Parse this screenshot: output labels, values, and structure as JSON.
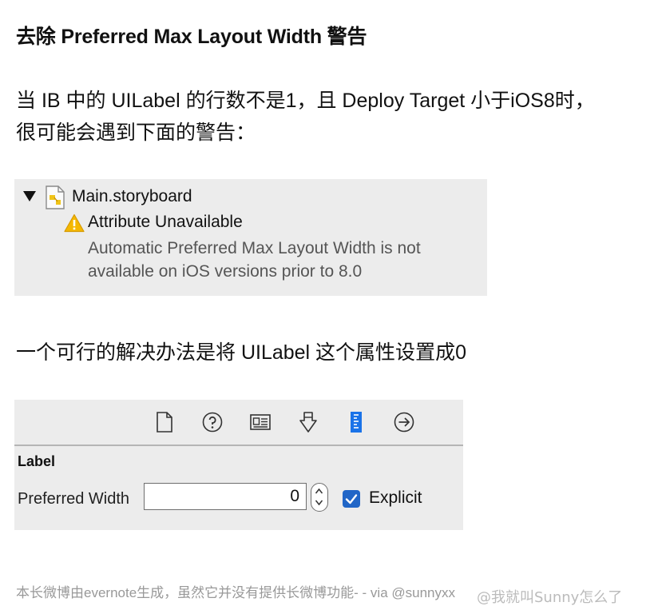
{
  "title": "去除 Preferred Max Layout Width 警告",
  "intro": {
    "line1": "当 IB 中的 UILabel 的行数不是1，且 Deploy Target 小于iOS8时，",
    "line2": "很可能会遇到下面的警告："
  },
  "issue_panel": {
    "file_name": "Main.storyboard",
    "warning_title": "Attribute Unavailable",
    "warning_message_line1": "Automatic Preferred Max Layout Width is not",
    "warning_message_line2": "available on iOS versions prior to 8.0",
    "icons": [
      "disclosure-triangle-icon",
      "storyboard-file-icon",
      "warning-icon"
    ],
    "colors": {
      "warning": "#f5b800",
      "panel_bg": "#ececec"
    }
  },
  "solution": "一个可行的解决办法是将 UILabel 这个属性设置成0",
  "inspector": {
    "toolbar_icons": [
      "file-icon",
      "help-icon",
      "identity-icon",
      "attributes-icon",
      "size-icon",
      "connections-icon"
    ],
    "section_label": "Label",
    "preferred_width_label": "Preferred Width",
    "preferred_width_value": "0",
    "explicit_label": "Explicit",
    "explicit_checked": true,
    "colors": {
      "accent": "#2166c7"
    }
  },
  "footer": "本长微博由evernote生成，虽然它并没有提供长微博功能- - via @sunnyxx",
  "watermark": "@我就叫Sunny怎么了"
}
